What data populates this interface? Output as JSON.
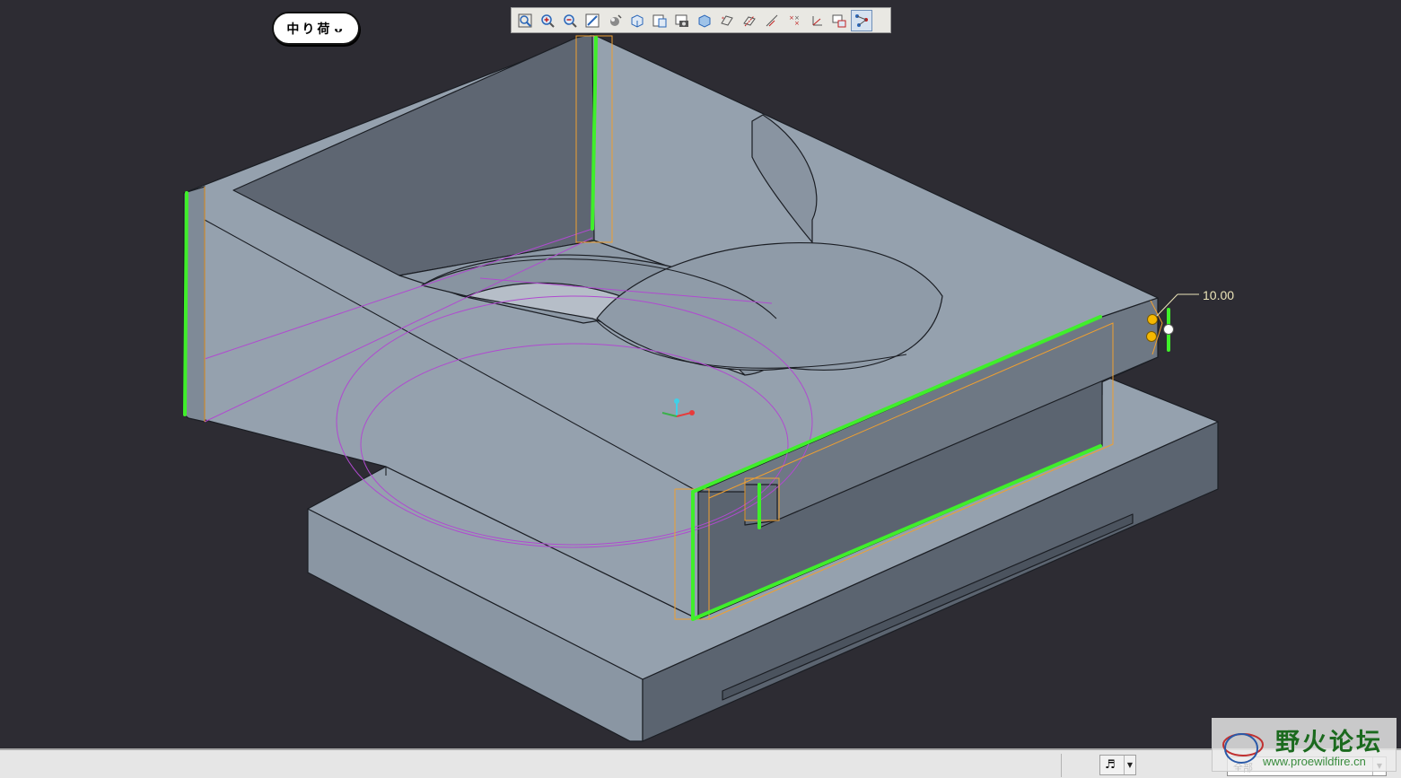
{
  "toolbar": {
    "buttons": [
      {
        "name": "refit-view-icon"
      },
      {
        "name": "zoom-in-icon"
      },
      {
        "name": "zoom-out-icon"
      },
      {
        "name": "repaint-icon"
      },
      {
        "name": "orient-mode-icon"
      },
      {
        "name": "saved-views-icon"
      },
      {
        "name": "display-style-icon"
      },
      {
        "name": "reorient-icon"
      },
      {
        "name": "view-manager-icon"
      },
      {
        "name": "datum-planes-icon"
      },
      {
        "name": "datum-axes-icon"
      },
      {
        "name": "datum-points-icon"
      },
      {
        "name": "coordinate-systems-icon"
      },
      {
        "name": "spin-center-icon"
      },
      {
        "name": "annotation-display-icon"
      },
      {
        "name": "model-tree-display-icon"
      }
    ],
    "active_index": 15
  },
  "logo_chip": {
    "text": "中り荷"
  },
  "model": {
    "dimension_value": "10.00",
    "colors": {
      "background": "#2d2c33",
      "face_top": "#95a1ae",
      "face_side": "#5b6470",
      "selection_highlight": "#3fef2a",
      "preview_outline": "#f0a030",
      "datum_curve": "#b04ad0",
      "dimension": "#ece5b8"
    }
  },
  "statusbar": {
    "filter_value": "全部"
  },
  "watermark": {
    "title": "野火论坛",
    "url": "www.proewildfire.cn"
  }
}
